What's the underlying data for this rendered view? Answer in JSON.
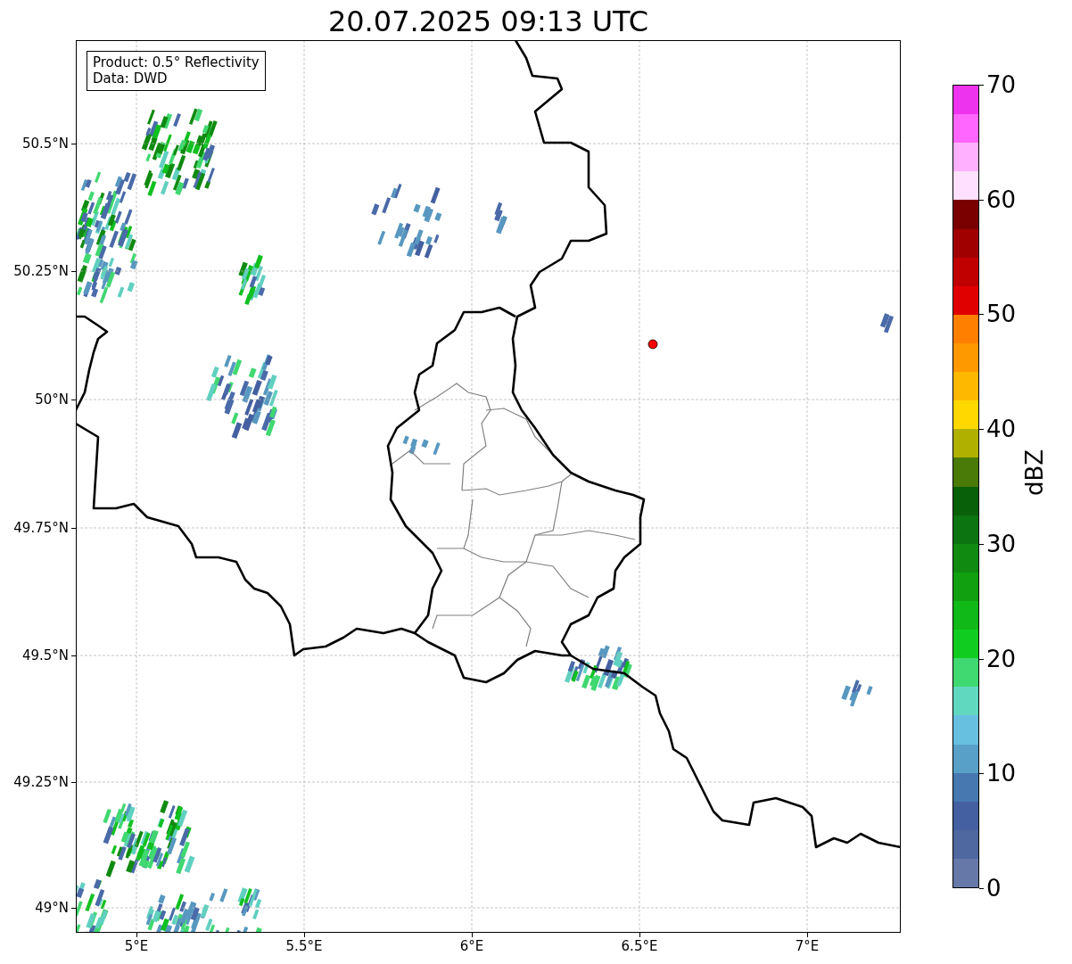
{
  "title": "20.07.2025 09:13 UTC",
  "legend": [
    "Product: 0.5° Reflectivity",
    "Data: DWD"
  ],
  "x_ticks": [
    "5°E",
    "5.5°E",
    "6°E",
    "6.5°E",
    "7°E"
  ],
  "y_ticks": [
    "50.5°N",
    "50.25°N",
    "50°N",
    "49.75°N",
    "49.5°N",
    "49.25°N",
    "49°N"
  ],
  "colorbar": {
    "label": "dBZ",
    "ticks": [
      "70",
      "60",
      "50",
      "40",
      "30",
      "20",
      "10",
      "0"
    ],
    "bins": [
      {
        "color": "#ee33ee"
      },
      {
        "color": "#ff66ff"
      },
      {
        "color": "#ffb0ff"
      },
      {
        "color": "#ffe0ff"
      },
      {
        "color": "#7a0000"
      },
      {
        "color": "#a00000"
      },
      {
        "color": "#c00000"
      },
      {
        "color": "#e00000"
      },
      {
        "color": "#ff8000"
      },
      {
        "color": "#ff9900"
      },
      {
        "color": "#ffb800"
      },
      {
        "color": "#ffd800"
      },
      {
        "color": "#b0b000"
      },
      {
        "color": "#4a7a08"
      },
      {
        "color": "#086008"
      },
      {
        "color": "#0c7410"
      },
      {
        "color": "#108a10"
      },
      {
        "color": "#10a010"
      },
      {
        "color": "#10b818"
      },
      {
        "color": "#10cc20"
      },
      {
        "color": "#40d870"
      },
      {
        "color": "#60d8c0"
      },
      {
        "color": "#68c0e0"
      },
      {
        "color": "#58a0c8"
      },
      {
        "color": "#4878b0"
      },
      {
        "color": "#4460a0"
      },
      {
        "color": "#5068a0"
      },
      {
        "color": "#6678a8"
      }
    ]
  }
}
